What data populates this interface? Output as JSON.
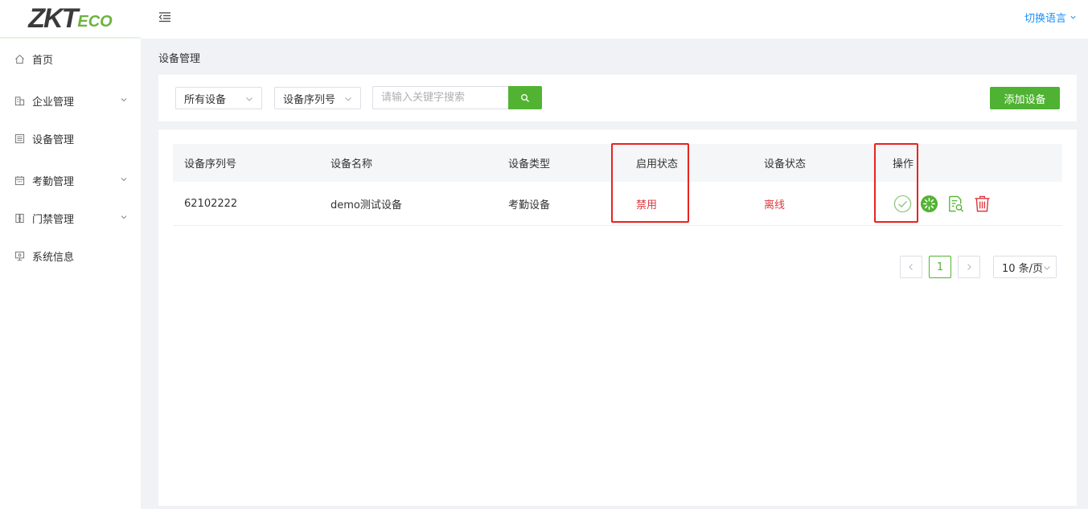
{
  "brand": {
    "logo_main": "ZKT",
    "logo_sub": "ECO",
    "accent": "#52b333"
  },
  "header": {
    "language_label": "切换语言"
  },
  "sidebar": {
    "items": [
      {
        "label": "首页",
        "icon": "home-icon"
      },
      {
        "label": "企业管理",
        "icon": "building-icon",
        "expandable": true
      },
      {
        "label": "设备管理",
        "icon": "device-list-icon"
      },
      {
        "label": "考勤管理",
        "icon": "calendar-icon",
        "expandable": true
      },
      {
        "label": "门禁管理",
        "icon": "door-icon",
        "expandable": true
      },
      {
        "label": "系统信息",
        "icon": "monitor-icon"
      }
    ]
  },
  "breadcrumb": {
    "current": "设备管理"
  },
  "toolbar": {
    "filter_device": "所有设备",
    "filter_field": "设备序列号",
    "search_placeholder": "请输入关键字搜索",
    "add_button": "添加设备"
  },
  "table": {
    "columns": [
      "设备序列号",
      "设备名称",
      "设备类型",
      "启用状态",
      "设备状态",
      "操作"
    ],
    "rows": [
      {
        "serial": "62102222",
        "name": "demo测试设备",
        "type": "考勤设备",
        "enabled": "禁用",
        "status": "离线"
      }
    ]
  },
  "pagination": {
    "current_page": "1",
    "page_size": "10 条/页"
  },
  "colors": {
    "danger": "#e0393e",
    "highlight": "#e8231f",
    "link": "#1890ff"
  }
}
